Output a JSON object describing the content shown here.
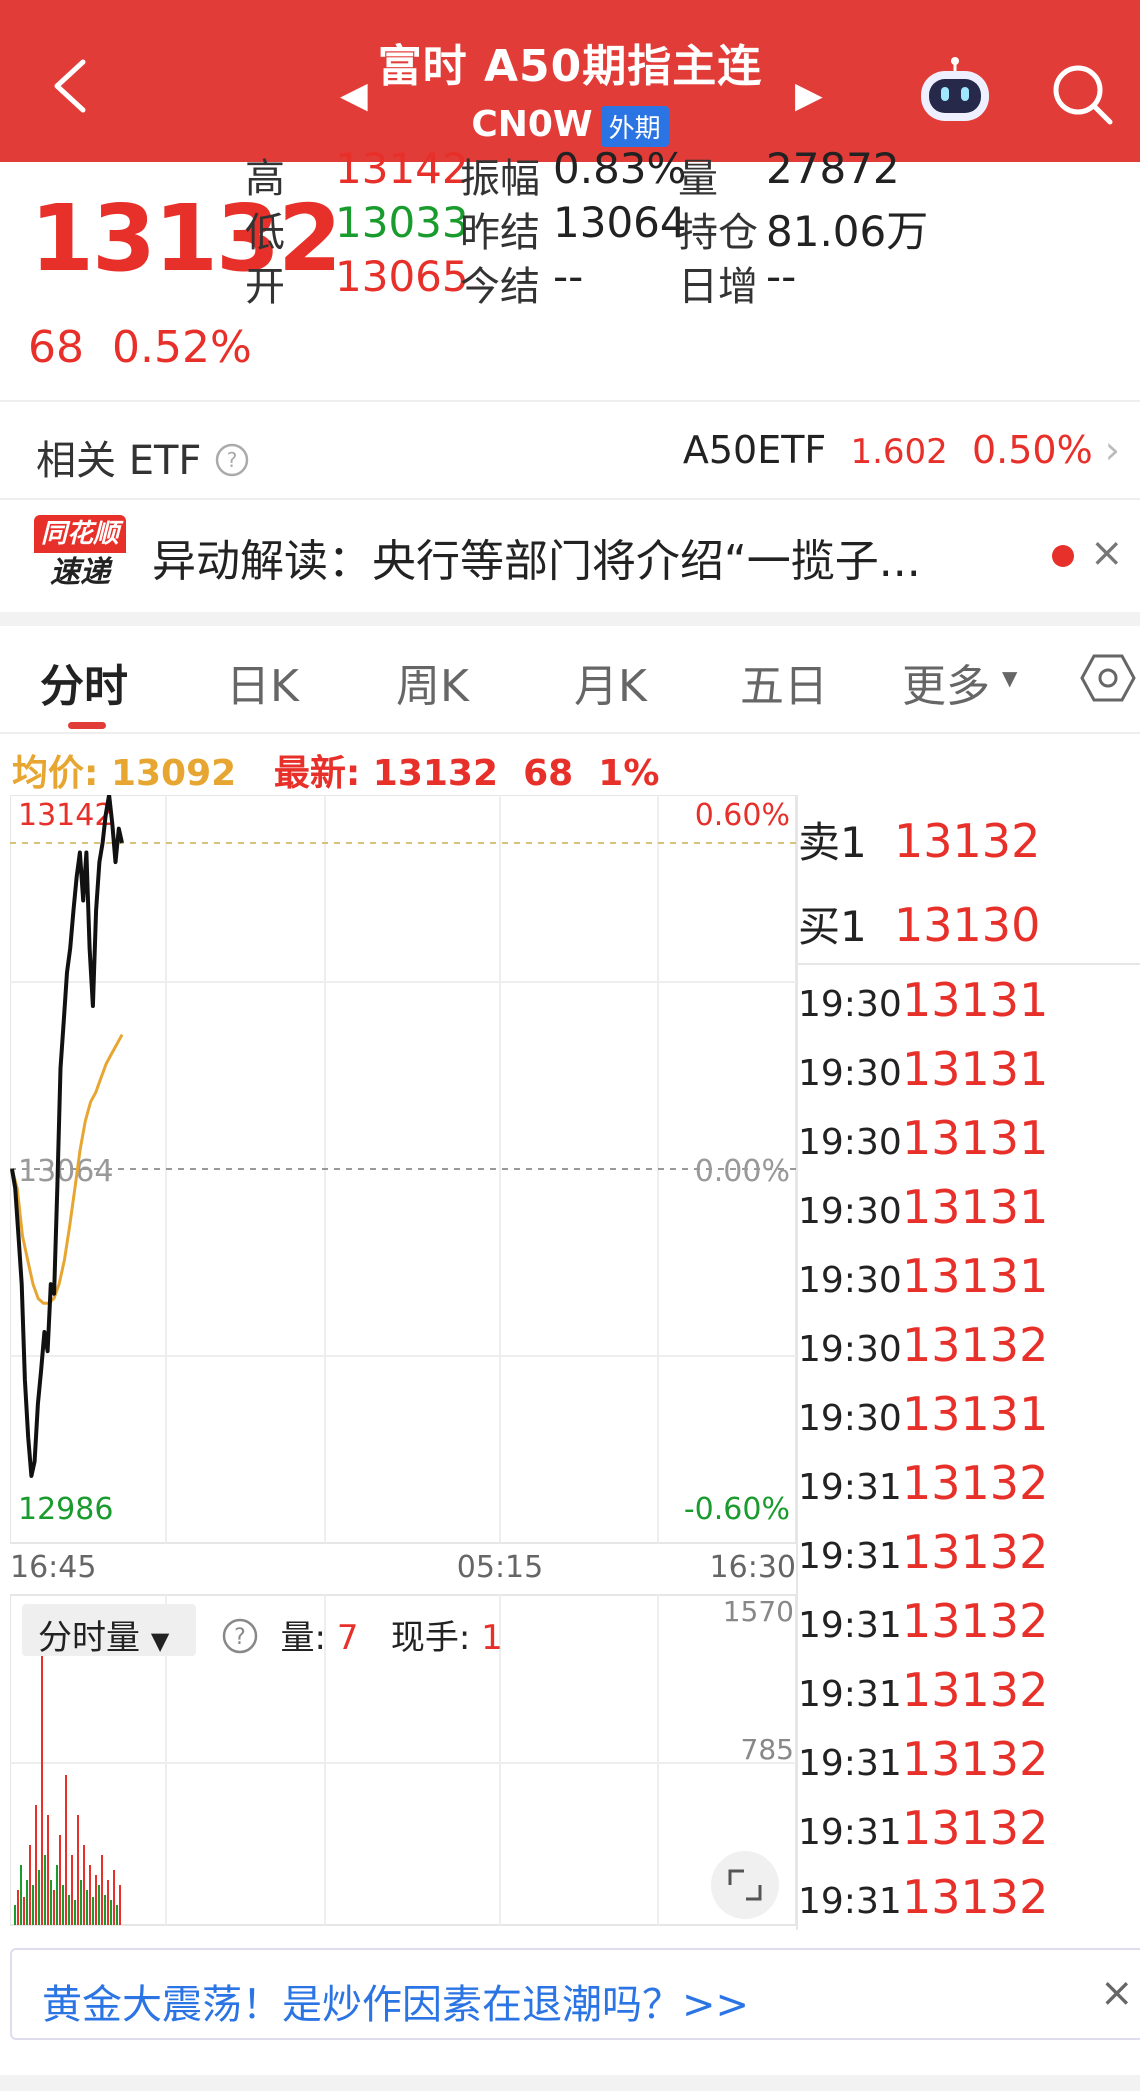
{
  "header": {
    "title": "富时 A50期指主连",
    "code": "CN0W",
    "tag": "外期",
    "prev": "◀",
    "next": "▶"
  },
  "quote": {
    "last": "13132",
    "change": "68",
    "change_pct": "0.52%",
    "stats": [
      {
        "label": "高",
        "value": "13142",
        "color": "red"
      },
      {
        "label": "低",
        "value": "13033",
        "color": "green"
      },
      {
        "label": "开",
        "value": "13065",
        "color": "red"
      },
      {
        "label": "振幅",
        "value": "0.83%",
        "color": "dark"
      },
      {
        "label": "昨结",
        "value": "13064",
        "color": "dark"
      },
      {
        "label": "今结",
        "value": "--",
        "color": "dark"
      },
      {
        "label": "量",
        "value": "27872",
        "color": "dark"
      },
      {
        "label": "持仓",
        "value": "81.06万",
        "color": "dark"
      },
      {
        "label": "日增",
        "value": "--",
        "color": "dark"
      }
    ]
  },
  "etf": {
    "label": "相关 ETF",
    "name": "A50ETF",
    "price": "1.602",
    "pct": "0.50%"
  },
  "news": {
    "logo_top": "同花顺",
    "logo_bottom": "速递",
    "text": "异动解读：央行等部门将介绍“一揽子..."
  },
  "tabs": [
    "分时",
    "日K",
    "周K",
    "月K",
    "五日",
    "更多"
  ],
  "info": {
    "avg_label": "均价:",
    "avg": "13092",
    "latest_label": "最新:",
    "latest": "13132",
    "chg": "68",
    "pct": "1%"
  },
  "chart": {
    "max_label": "13142",
    "base_label": "13064",
    "min_label": "12986",
    "pct_top": "0.60%",
    "pct_mid": "0.00%",
    "pct_bottom": "-0.60%",
    "time_start": "16:45",
    "time_mid": "05:15",
    "time_end": "16:30",
    "vol_max": "1570",
    "vol_mid": "785"
  },
  "chart_data": {
    "type": "line",
    "base": 13064,
    "ylim": [
      12986,
      13142
    ],
    "price_series": [
      13064,
      13060,
      13050,
      13040,
      13020,
      13008,
      13000,
      13003,
      13015,
      13022,
      13030,
      13026,
      13040,
      13038,
      13060,
      13085,
      13095,
      13105,
      13110,
      13118,
      13125,
      13130,
      13120,
      13130,
      13110,
      13098,
      13118,
      13128,
      13132,
      13138,
      13142,
      13136,
      13128,
      13135,
      13132
    ],
    "avg_series": [
      13064,
      13060,
      13050,
      13045,
      13040,
      13037,
      13036,
      13036,
      13037,
      13040,
      13045,
      13052,
      13060,
      13068,
      13074,
      13078,
      13080,
      13083,
      13086,
      13088,
      13090,
      13092
    ]
  },
  "book": {
    "sell_label": "卖1",
    "sell_price": "13132",
    "buy_label": "买1",
    "buy_price": "13130"
  },
  "trades": [
    {
      "time": "19:30",
      "price": "13131"
    },
    {
      "time": "19:30",
      "price": "13131"
    },
    {
      "time": "19:30",
      "price": "13131"
    },
    {
      "time": "19:30",
      "price": "13131"
    },
    {
      "time": "19:30",
      "price": "13131"
    },
    {
      "time": "19:30",
      "price": "13132"
    },
    {
      "time": "19:30",
      "price": "13131"
    },
    {
      "time": "19:31",
      "price": "13132"
    },
    {
      "time": "19:31",
      "price": "13132"
    },
    {
      "time": "19:31",
      "price": "13132"
    },
    {
      "time": "19:31",
      "price": "13132"
    },
    {
      "time": "19:31",
      "price": "13132"
    },
    {
      "time": "19:31",
      "price": "13132"
    },
    {
      "time": "19:31",
      "price": "13132"
    }
  ],
  "volume": {
    "dropdown": "分时量",
    "qty_label": "量:",
    "qty": "7",
    "now_label": "现手:",
    "now": "1"
  },
  "banner": {
    "text": "黄金大震荡！是炒作因素在退潮吗？>>"
  },
  "colors": {
    "header": "#e23c38",
    "up": "#e8302a",
    "down": "#1a9b2e",
    "avg": "#e6a631",
    "link": "#2b74e4"
  }
}
